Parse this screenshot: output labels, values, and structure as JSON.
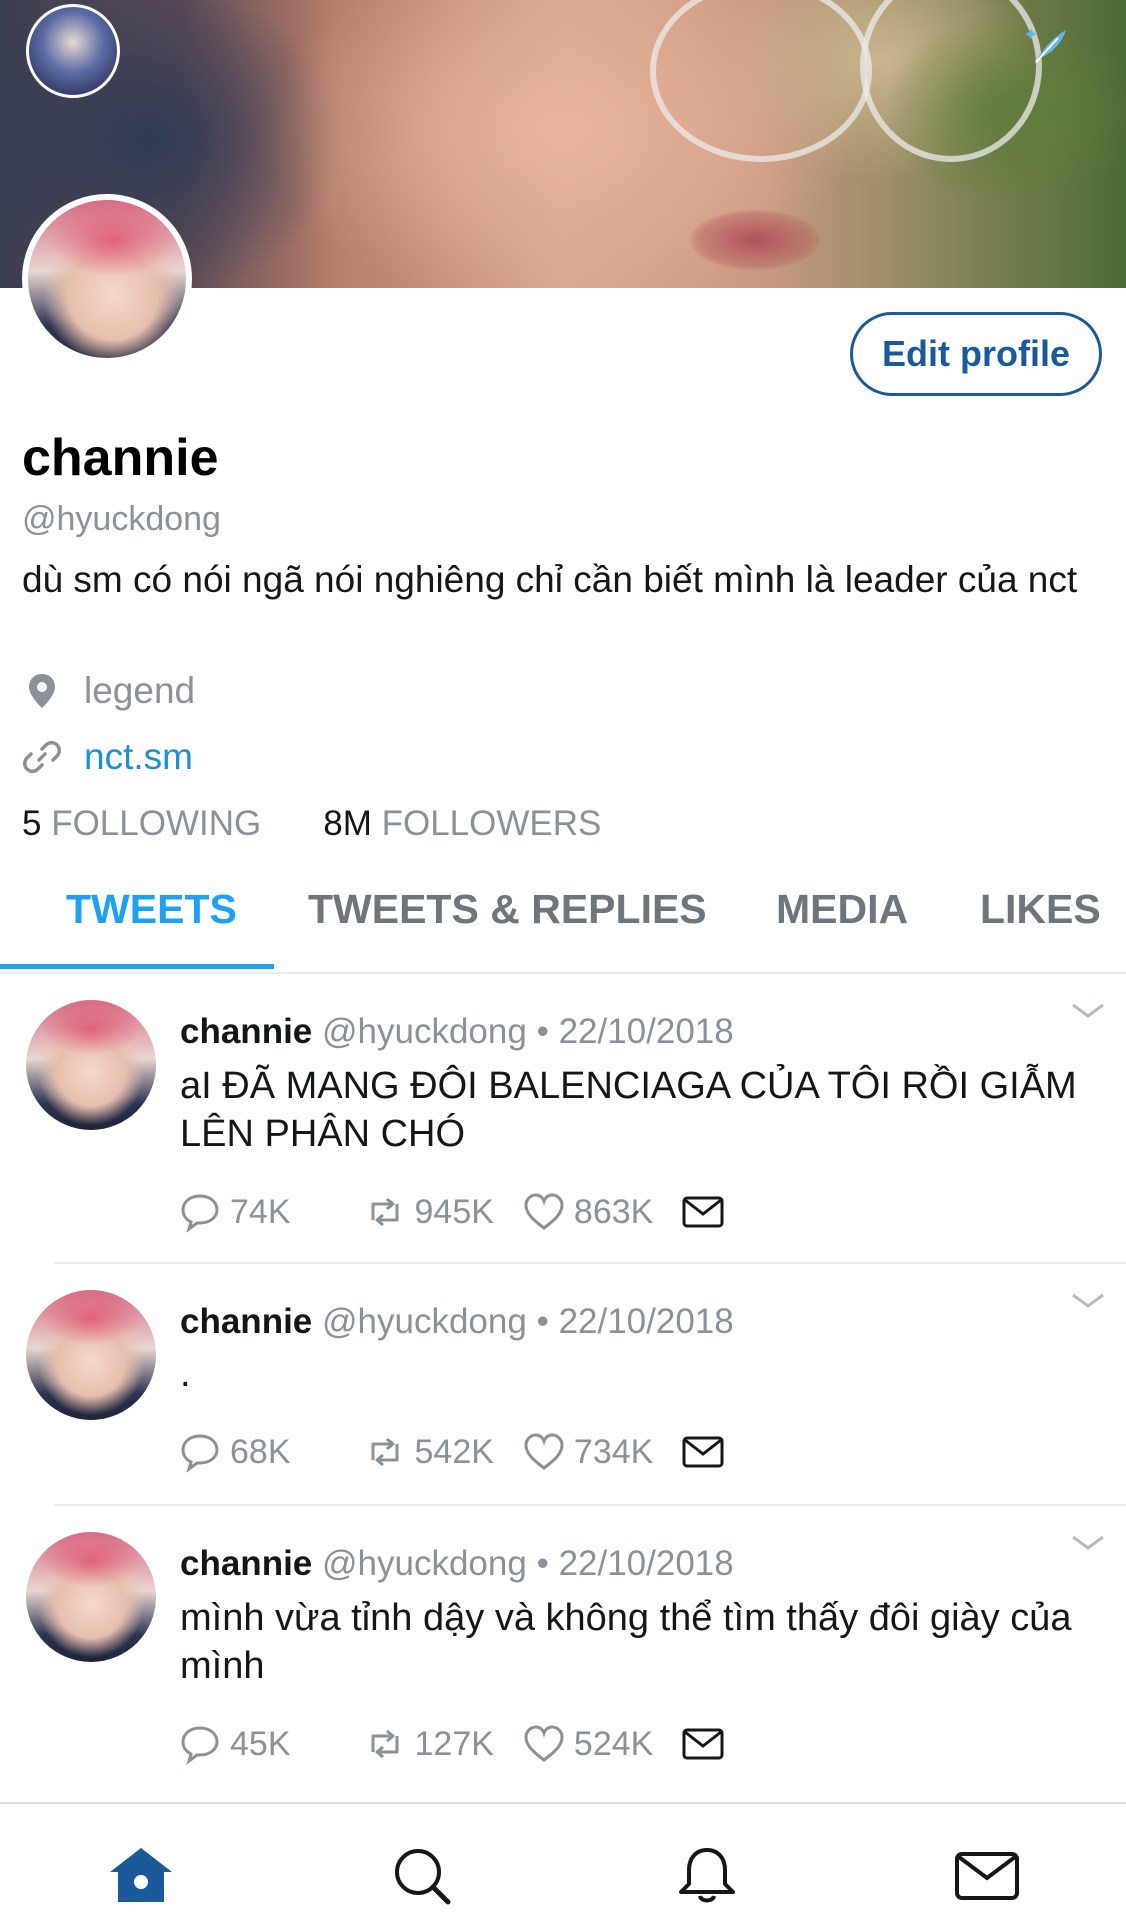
{
  "profile": {
    "display_name": "channie",
    "handle": "@hyuckdong",
    "bio": "dù sm có nói ngã nói nghiêng chỉ cần biết mình là leader của nct",
    "location": "legend",
    "website": "nct.sm",
    "edit_profile_label": "Edit profile",
    "following_count": "5",
    "following_label": "FOLLOWING",
    "followers_count": "8M",
    "followers_label": "FOLLOWERS"
  },
  "tabs": [
    {
      "label": "TWEETS",
      "active": true
    },
    {
      "label": "TWEETS & REPLIES",
      "active": false
    },
    {
      "label": "MEDIA",
      "active": false
    },
    {
      "label": "LIKES",
      "active": false
    }
  ],
  "tweets": [
    {
      "name": "channie",
      "handle": "@hyuckdong",
      "separator": "•",
      "date": "22/10/2018",
      "text": "aI ĐÃ MANG ĐÔI BALENCIAGA CỦA TÔI RỒI GIẪM LÊN PHÂN CHÓ",
      "replies": "74K",
      "retweets": "945K",
      "likes": "863K"
    },
    {
      "name": "channie",
      "handle": "@hyuckdong",
      "separator": "•",
      "date": "22/10/2018",
      "text": ".",
      "replies": "68K",
      "retweets": "542K",
      "likes": "734K"
    },
    {
      "name": "channie",
      "handle": "@hyuckdong",
      "separator": "•",
      "date": "22/10/2018",
      "text": "mình vừa tỉnh dậy và không thể tìm thấy đôi giày của mình",
      "replies": "45K",
      "retweets": "127K",
      "likes": "524K"
    }
  ],
  "colors": {
    "accent": "#1da1f2",
    "edit_button": "#1b5a9a",
    "muted": "#8a9199",
    "nav_active": "#1b5a9a"
  },
  "icons": {
    "compose": "feather-icon",
    "location": "location-pin-icon",
    "link": "link-icon",
    "reply": "reply-icon",
    "retweet": "retweet-icon",
    "like": "heart-icon",
    "dm": "envelope-icon",
    "nav": [
      "home-icon",
      "search-icon",
      "notifications-icon",
      "messages-icon"
    ]
  }
}
